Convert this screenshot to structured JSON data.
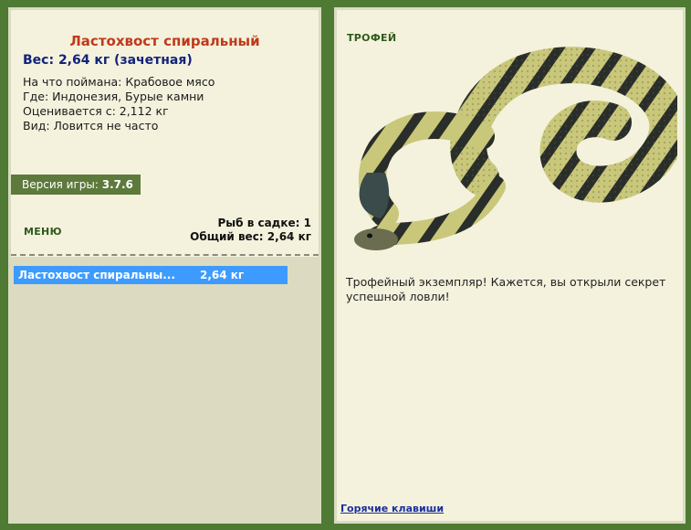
{
  "left": {
    "title": "Ластохвост спиральный",
    "weight_line": "Вес: 2,64 кг (зачетная)",
    "details": [
      "На что поймана: Крабовое мясо",
      "Где: Индонезия, Бурые камни",
      "Оценивается с: 2,112 кг",
      "Вид: Ловится не часто"
    ],
    "version_label": "Версия игры: ",
    "version_value": "3.7.6",
    "menu_label": "МЕНЮ",
    "fish_count": "Рыб в садке: 1",
    "total_weight": "Общий вес: 2,64 кг",
    "catch": [
      {
        "name": "Ластохвост спиральны...",
        "weight": "2,64 кг"
      }
    ]
  },
  "right": {
    "trophy_label": "ТРОФЕЙ",
    "image_subject": "sea-snake",
    "trophy_text": "Трофейный экземпляр! Кажется, вы открыли секрет успешной ловли!",
    "hotkeys_label": "Горячие клавиши"
  },
  "colors": {
    "background": "#4f7a34",
    "panel": "#f4f2dd",
    "title": "#c0391a",
    "weight": "#12237a",
    "selection": "#3d9bff",
    "version_bar": "#5d7a3c"
  }
}
